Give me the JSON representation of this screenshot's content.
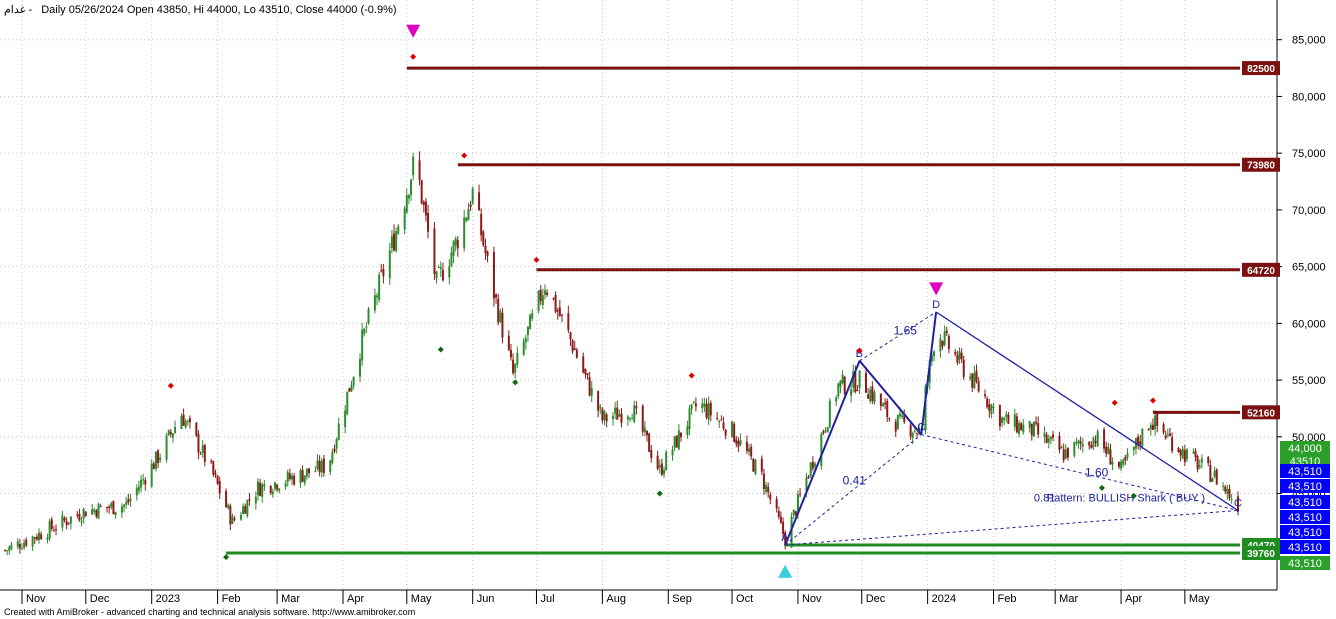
{
  "header": {
    "ticker": "غدام -",
    "title": "Daily 05/26/2024 Open 43850, Hi 44000, Lo 43510, Close 44000 (-0.9%)"
  },
  "footer": {
    "credit": "Created with AmiBroker - advanced charting and technical analysis software. http://www.amibroker.com"
  },
  "colors": {
    "background": "#ffffff",
    "up_candle": "#2e8b2e",
    "down_candle": "#8b1a1a",
    "resistance": "#7a1010",
    "support": "#1e8c1e",
    "pattern": "#2020a0",
    "marker_top": "#e000c0",
    "marker_bottom": "#30d0e0",
    "peak_dot": "#e00000",
    "trough_dot": "#116611",
    "price_tag_blue": "#0000ff"
  },
  "chart_data": {
    "type": "candlestick",
    "x_range": [
      "2022-10-24",
      "2024-05-26"
    ],
    "ylim": [
      36500,
      88500
    ],
    "y_ticks": [
      45000,
      50000,
      55000,
      60000,
      65000,
      70000,
      75000,
      80000,
      85000
    ],
    "y_tick_labels": [
      "45,000",
      "50,000",
      "55,000",
      "60,000",
      "65,000",
      "70,000",
      "75,000",
      "80,000",
      "85,000"
    ],
    "month_ticks": [
      {
        "date": "2022-11-01",
        "label": "Nov"
      },
      {
        "date": "2022-12-01",
        "label": "Dec"
      },
      {
        "date": "2023-01-01",
        "label": "2023"
      },
      {
        "date": "2023-02-01",
        "label": "Feb"
      },
      {
        "date": "2023-03-01",
        "label": "Mar"
      },
      {
        "date": "2023-04-01",
        "label": "Apr"
      },
      {
        "date": "2023-05-01",
        "label": "May"
      },
      {
        "date": "2023-06-01",
        "label": "Jun"
      },
      {
        "date": "2023-07-01",
        "label": "Jul"
      },
      {
        "date": "2023-08-01",
        "label": "Aug"
      },
      {
        "date": "2023-09-01",
        "label": "Sep"
      },
      {
        "date": "2023-10-01",
        "label": "Oct"
      },
      {
        "date": "2023-11-01",
        "label": "Nov"
      },
      {
        "date": "2023-12-01",
        "label": "Dec"
      },
      {
        "date": "2024-01-01",
        "label": "2024"
      },
      {
        "date": "2024-02-01",
        "label": "Feb"
      },
      {
        "date": "2024-03-01",
        "label": "Mar"
      },
      {
        "date": "2024-04-01",
        "label": "Apr"
      },
      {
        "date": "2024-05-01",
        "label": "May"
      }
    ],
    "price_path": [
      {
        "date": "2022-10-24",
        "close": 40000
      },
      {
        "date": "2022-11-10",
        "close": 41500
      },
      {
        "date": "2022-12-01",
        "close": 43500
      },
      {
        "date": "2022-12-20",
        "close": 44000
      },
      {
        "date": "2023-01-05",
        "close": 48500
      },
      {
        "date": "2023-01-15",
        "close": 52000
      },
      {
        "date": "2023-01-28",
        "close": 47500
      },
      {
        "date": "2023-02-08",
        "close": 42500
      },
      {
        "date": "2023-02-20",
        "close": 45500
      },
      {
        "date": "2023-03-10",
        "close": 46500
      },
      {
        "date": "2023-03-25",
        "close": 47500
      },
      {
        "date": "2023-04-10",
        "close": 58500
      },
      {
        "date": "2023-04-25",
        "close": 67500
      },
      {
        "date": "2023-05-05",
        "close": 74500
      },
      {
        "date": "2023-05-15",
        "close": 63500
      },
      {
        "date": "2023-05-25",
        "close": 67500
      },
      {
        "date": "2023-06-01",
        "close": 71500
      },
      {
        "date": "2023-06-10",
        "close": 63500
      },
      {
        "date": "2023-06-20",
        "close": 55500
      },
      {
        "date": "2023-07-05",
        "close": 63500
      },
      {
        "date": "2023-07-15",
        "close": 59500
      },
      {
        "date": "2023-08-01",
        "close": 51500
      },
      {
        "date": "2023-08-15",
        "close": 52500
      },
      {
        "date": "2023-08-28",
        "close": 47000
      },
      {
        "date": "2023-09-15",
        "close": 53000
      },
      {
        "date": "2023-10-01",
        "close": 50500
      },
      {
        "date": "2023-10-15",
        "close": 46500
      },
      {
        "date": "2023-10-26",
        "close": 41000
      },
      {
        "date": "2023-11-10",
        "close": 49000
      },
      {
        "date": "2023-11-20",
        "close": 54500
      },
      {
        "date": "2023-12-01",
        "close": 55000
      },
      {
        "date": "2023-12-15",
        "close": 51500
      },
      {
        "date": "2023-12-28",
        "close": 50500
      },
      {
        "date": "2024-01-05",
        "close": 59500
      },
      {
        "date": "2024-01-20",
        "close": 55500
      },
      {
        "date": "2024-02-05",
        "close": 51500
      },
      {
        "date": "2024-02-20",
        "close": 50500
      },
      {
        "date": "2024-03-05",
        "close": 48500
      },
      {
        "date": "2024-03-20",
        "close": 50000
      },
      {
        "date": "2024-04-01",
        "close": 47000
      },
      {
        "date": "2024-04-15",
        "close": 51500
      },
      {
        "date": "2024-05-01",
        "close": 48500
      },
      {
        "date": "2024-05-15",
        "close": 46500
      },
      {
        "date": "2024-05-26",
        "close": 44000
      }
    ],
    "resistance_lines": [
      {
        "value": 82500,
        "label": "82500",
        "from": "2023-05-01"
      },
      {
        "value": 73980,
        "label": "73980",
        "from": "2023-05-25"
      },
      {
        "value": 64720,
        "label": "64720",
        "from": "2023-07-01"
      },
      {
        "value": 52160,
        "label": "52160",
        "from": "2024-04-16"
      }
    ],
    "support_lines": [
      {
        "value": 40470,
        "label": "40470",
        "from": "2023-10-26"
      },
      {
        "value": 39760,
        "label": "39760",
        "from": "2023-02-05"
      }
    ],
    "price_tags": [
      {
        "value": 44000,
        "label": "44,000",
        "style": "green"
      },
      {
        "value": 43510,
        "label": "43510",
        "style": "green"
      },
      {
        "value": 43510,
        "label": "43,510",
        "style": "blue"
      },
      {
        "value": 43510,
        "label": "43,510",
        "style": "blue"
      },
      {
        "value": 43510,
        "label": "43,510",
        "style": "blue"
      },
      {
        "value": 43510,
        "label": "43,510",
        "style": "blue"
      },
      {
        "value": 43510,
        "label": "43,510",
        "style": "blue"
      },
      {
        "value": 43510,
        "label": "43,510",
        "style": "blue"
      },
      {
        "value": 43510,
        "label": "43,510",
        "style": "green"
      }
    ],
    "harmonic_pattern": {
      "label": "Pattern: BULLISH Shark ( BUY )",
      "label_overprint": "0.81",
      "points": [
        {
          "name": "A",
          "date": "2023-10-26",
          "value": 40470
        },
        {
          "name": "B",
          "date": "2023-11-30",
          "value": 56700
        },
        {
          "name": "C",
          "date": "2023-12-29",
          "value": 50200
        },
        {
          "name": "D",
          "date": "2024-01-05",
          "value": 61000
        },
        {
          "name": "C",
          "date": "2024-05-26",
          "value": 43510
        }
      ],
      "ratios": [
        {
          "label": "1.65",
          "date": "2023-12-16",
          "value": 59000
        },
        {
          "label": "0.41",
          "date": "2023-11-22",
          "value": 45800
        },
        {
          "label": "1.60",
          "date": "2024-03-15",
          "value": 46500
        }
      ]
    },
    "top_markers": [
      {
        "date": "2023-05-04",
        "value": 85700
      },
      {
        "date": "2024-01-05",
        "value": 63000
      }
    ],
    "bottom_markers": [
      {
        "date": "2023-10-26",
        "value": 38200
      }
    ],
    "peak_dots": [
      {
        "date": "2023-01-10",
        "value": 54500
      },
      {
        "date": "2023-05-04",
        "value": 83500
      },
      {
        "date": "2023-05-28",
        "value": 74800
      },
      {
        "date": "2023-07-01",
        "value": 65600
      },
      {
        "date": "2023-09-12",
        "value": 55400
      },
      {
        "date": "2023-11-30",
        "value": 57600
      },
      {
        "date": "2024-03-29",
        "value": 53000
      },
      {
        "date": "2024-04-16",
        "value": 53200
      }
    ],
    "trough_dots": [
      {
        "date": "2023-02-05",
        "value": 39400
      },
      {
        "date": "2023-05-17",
        "value": 57700
      },
      {
        "date": "2023-06-21",
        "value": 54800
      },
      {
        "date": "2023-08-28",
        "value": 45000
      },
      {
        "date": "2024-03-23",
        "value": 45500
      },
      {
        "date": "2024-04-07",
        "value": 44800
      }
    ]
  }
}
